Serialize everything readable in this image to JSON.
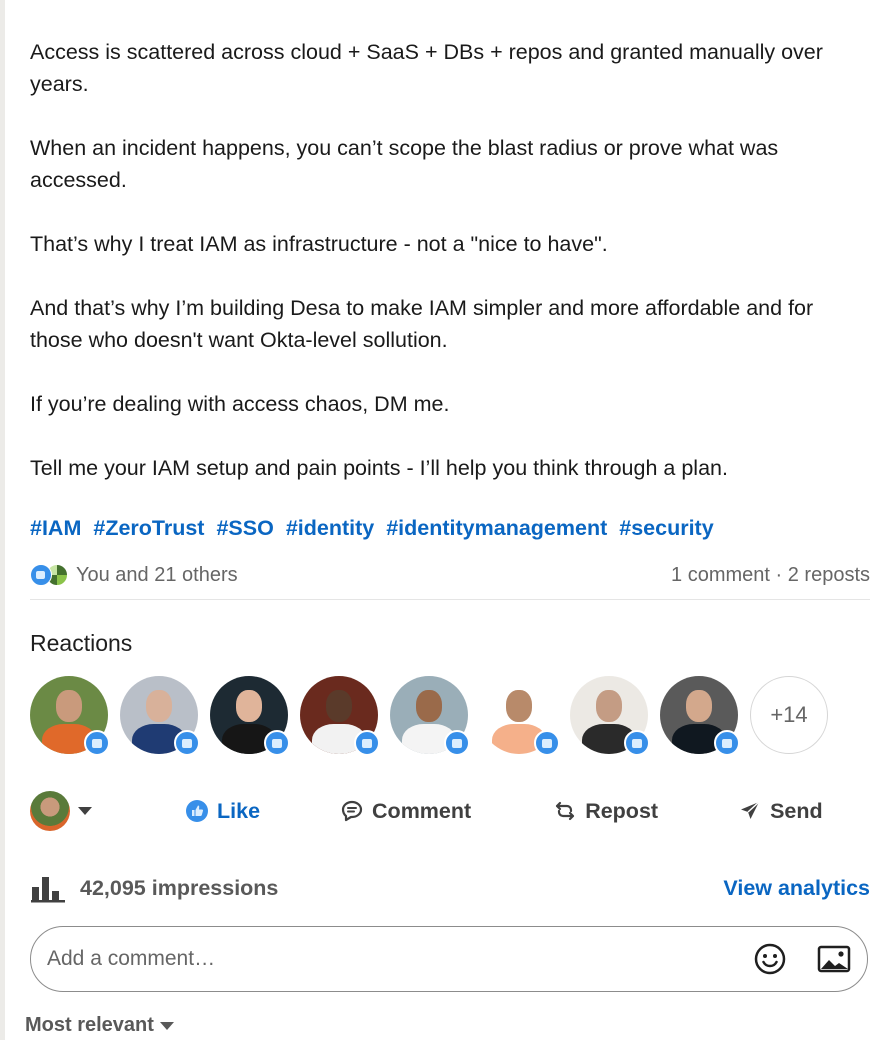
{
  "post": {
    "paragraphs": [
      "Access is scattered across cloud + SaaS + DBs + repos and granted manually over years.",
      "When an incident happens, you can’t scope the blast radius or prove what was accessed.",
      "That’s why I treat IAM as infrastructure - not a \"nice to have\".",
      "And that’s why I’m building Desa to make IAM simpler and more affordable and for those who doesn't want Okta-level sollution.",
      "If you’re dealing with access chaos, DM me.",
      "Tell me your IAM setup and pain points - I’ll help you think through a plan."
    ],
    "hashtags": [
      "#IAM",
      "#ZeroTrust",
      "#SSO",
      "#identity",
      "#identitymanagement",
      "#security"
    ]
  },
  "social": {
    "reactors_text": "You and 21 others",
    "comments_text": "1 comment",
    "separator": " · ",
    "reposts_text": "2 reposts",
    "reaction_icons": [
      "like-icon",
      "celebrate-icon"
    ]
  },
  "reactions": {
    "title": "Reactions",
    "avatars": [
      {
        "bg": "#6b8a45",
        "shirt": "#e0692a",
        "head": "#c99a7c"
      },
      {
        "bg": "#b9bfc8",
        "shirt": "#1f3b73",
        "head": "#d8b19a"
      },
      {
        "bg": "#1d2a33",
        "shirt": "#161616",
        "head": "#e0b49a"
      },
      {
        "bg": "#6a2a1e",
        "shirt": "#f2f2f2",
        "head": "#5a3a2a"
      },
      {
        "bg": "#9aaeb8",
        "shirt": "#f4f4f4",
        "head": "#9a6a4a"
      },
      {
        "bg": "#ffffff",
        "shirt": "#f5b08a",
        "head": "#b88a6a"
      },
      {
        "bg": "#ece9e4",
        "shirt": "#2a2a2a",
        "head": "#c49c84"
      },
      {
        "bg": "#5a5a5a",
        "shirt": "#101820",
        "head": "#d3a88c"
      }
    ],
    "more_label": "+14",
    "badge_icon": "like-icon"
  },
  "actions": {
    "like": "Like",
    "comment": "Comment",
    "repost": "Repost",
    "send": "Send"
  },
  "impressions": {
    "text": "42,095 impressions",
    "link": "View analytics"
  },
  "comment_box": {
    "placeholder": "Add a comment…"
  },
  "sort": {
    "label": "Most relevant"
  },
  "colors": {
    "accent": "#0a66c2",
    "like_blue": "#378fe9"
  }
}
